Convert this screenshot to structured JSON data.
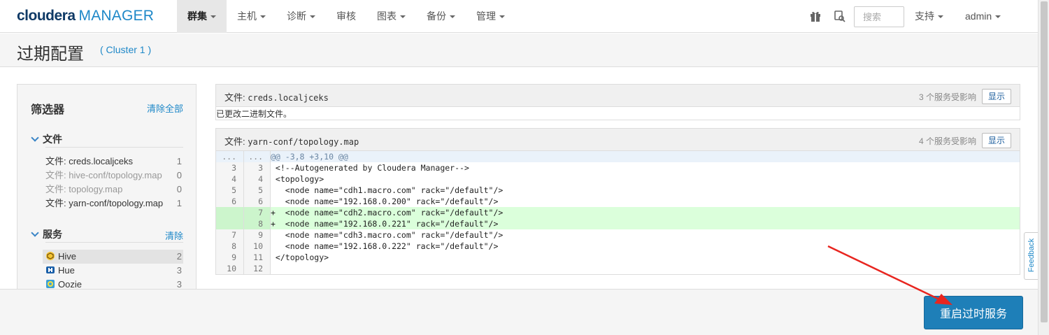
{
  "app": {
    "brand": "cloudera",
    "product": "MANAGER"
  },
  "nav": {
    "items": [
      {
        "label": "群集",
        "active": true
      },
      {
        "label": "主机"
      },
      {
        "label": "诊断"
      },
      {
        "label": "审核"
      },
      {
        "label": "图表"
      },
      {
        "label": "备份"
      },
      {
        "label": "管理"
      }
    ],
    "search_placeholder": "搜索",
    "support_label": "支持",
    "user_label": "admin",
    "icons": [
      "gift-icon",
      "wizard-icon"
    ]
  },
  "page": {
    "title": "过期配置",
    "cluster": "( Cluster 1 )"
  },
  "filters": {
    "title": "筛选器",
    "clear_all": "清除全部",
    "files_section": "文件",
    "files": [
      {
        "label": "文件: creds.localjceks",
        "count": "1"
      },
      {
        "label": "文件: hive-conf/topology.map",
        "count": "0"
      },
      {
        "label": "文件: topology.map",
        "count": "0"
      },
      {
        "label": "文件: yarn-conf/topology.map",
        "count": "1"
      }
    ],
    "services_section": "服务",
    "services_clear": "清除",
    "services": [
      {
        "label": "Hive",
        "count": "2",
        "icon": "hive-icon"
      },
      {
        "label": "Hue",
        "count": "3",
        "icon": "hue-icon"
      },
      {
        "label": "Oozie",
        "count": "3",
        "icon": "oozie-icon"
      }
    ]
  },
  "file_panels": [
    {
      "label": "文件:",
      "filename": "creds.localjceks",
      "affected": "3 个服务受影响",
      "show_label": "显示",
      "message": "已更改二进制文件。"
    },
    {
      "label": "文件:",
      "filename": "yarn-conf/topology.map",
      "affected": "4 个服务受影响",
      "show_label": "显示"
    }
  ],
  "diff": [
    {
      "old": "...",
      "new": "...",
      "type": "hunk",
      "text": "@@ -3,8 +3,10 @@"
    },
    {
      "old": "3",
      "new": "3",
      "type": "ctx",
      "text": " <!--Autogenerated by Cloudera Manager-->"
    },
    {
      "old": "4",
      "new": "4",
      "type": "ctx",
      "text": " <topology>"
    },
    {
      "old": "5",
      "new": "5",
      "type": "ctx",
      "text": "   <node name=\"cdh1.macro.com\" rack=\"/default\"/>"
    },
    {
      "old": "6",
      "new": "6",
      "type": "ctx",
      "text": "   <node name=\"192.168.0.200\" rack=\"/default\"/>"
    },
    {
      "old": "",
      "new": "7",
      "type": "add",
      "text": "+  <node name=\"cdh2.macro.com\" rack=\"/default\"/>"
    },
    {
      "old": "",
      "new": "8",
      "type": "add",
      "text": "+  <node name=\"192.168.0.221\" rack=\"/default\"/>"
    },
    {
      "old": "7",
      "new": "9",
      "type": "ctx",
      "text": "   <node name=\"cdh3.macro.com\" rack=\"/default\"/>"
    },
    {
      "old": "8",
      "new": "10",
      "type": "ctx",
      "text": "   <node name=\"192.168.0.222\" rack=\"/default\"/>"
    },
    {
      "old": "9",
      "new": "11",
      "type": "ctx",
      "text": " </topology>"
    },
    {
      "old": "10",
      "new": "12",
      "type": "ctx",
      "text": ""
    }
  ],
  "footer": {
    "restart_label": "重启过时服务"
  },
  "feedback_label": "Feedback",
  "colors": {
    "accent": "#1e88c8",
    "brand_dark": "#0f3a66",
    "primary_button": "#1e7fb8",
    "diff_add": "#dbffdb",
    "annotation_arrow": "#e8251f"
  }
}
